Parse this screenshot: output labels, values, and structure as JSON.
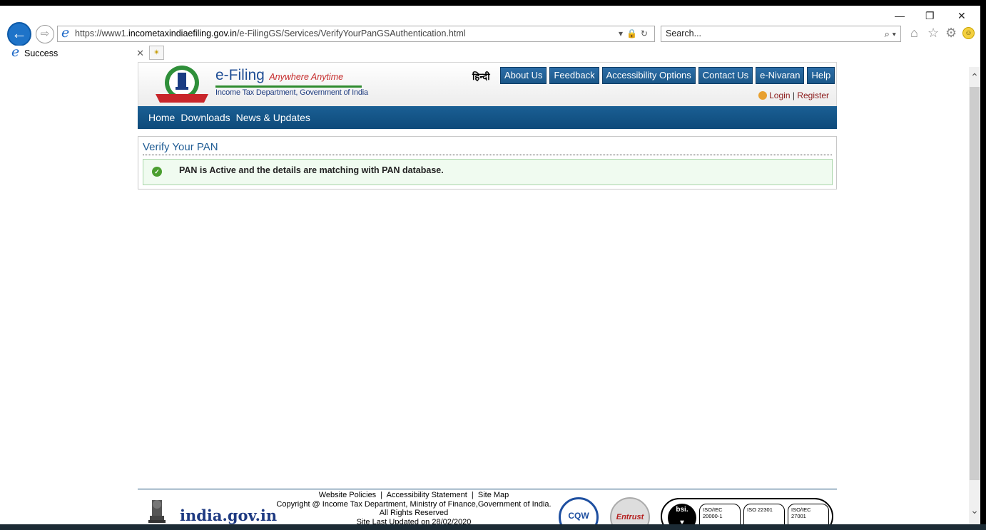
{
  "browser": {
    "url_prefix": "https://www1.",
    "url_domain": "incometaxindiaefiling.gov.in",
    "url_path": "/e-FilingGS/Services/VerifyYourPanGSAuthentication.html",
    "search_placeholder": "Search...",
    "tab_title": "Success",
    "icons": [
      "back-icon",
      "forward-icon",
      "lock-icon",
      "refresh-icon",
      "search-icon",
      "home-icon",
      "favorites-icon",
      "settings-icon",
      "smiley-icon"
    ]
  },
  "header": {
    "efiling": "e-Filing",
    "tagline": "Anywhere Anytime",
    "department": "Income Tax Department, Government of India",
    "hindi": "हिन्दी",
    "topnav": [
      "About Us",
      "Feedback",
      "Accessibility Options",
      "Contact Us",
      "e-Nivaran",
      "Help"
    ],
    "login": "Login",
    "register": "Register"
  },
  "mainnav": [
    "Home",
    "Downloads",
    "News & Updates"
  ],
  "panel": {
    "title": "Verify Your PAN",
    "message": "PAN is Active and the details are matching with PAN database."
  },
  "footer": {
    "links": [
      "Website Policies",
      "Accessibility Statement",
      "Site Map"
    ],
    "copyright": "Copyright @ Income Tax Department, Ministry of Finance,Government of India.",
    "rights": "All Rights Reserved",
    "updated": "Site Last Updated on 28/02/2020",
    "indiagov": "india.gov.in",
    "cert1": "ISO/IEC 20000-1",
    "cert2": "ISO 22301",
    "cert3": "ISO/IEC 27001"
  },
  "colors": {
    "nav_blue": "#1b5788",
    "brand_blue": "#1f4e95",
    "success_green": "#4a9e2f"
  }
}
